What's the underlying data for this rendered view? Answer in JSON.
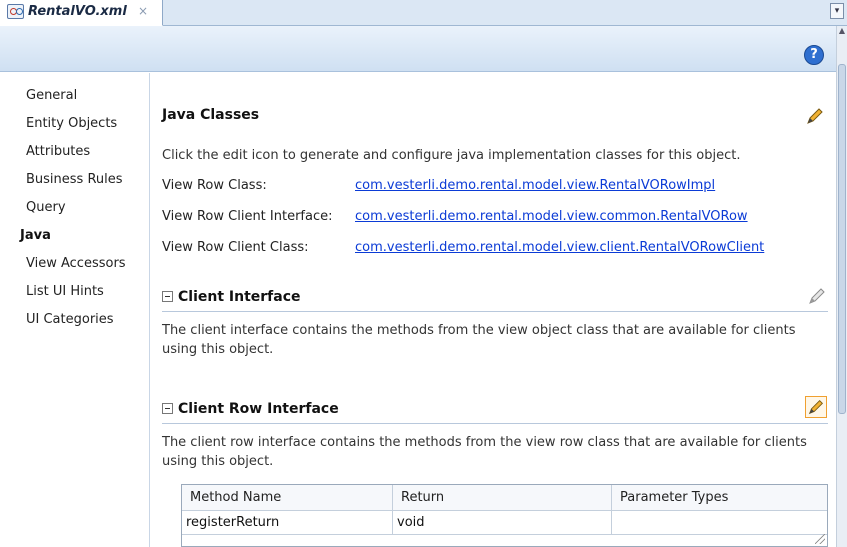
{
  "tab": {
    "title": "RentalVO.xml",
    "close": "×",
    "menu": "▾"
  },
  "header": {
    "help": "?"
  },
  "sidebar": {
    "items": [
      {
        "label": "General"
      },
      {
        "label": "Entity Objects"
      },
      {
        "label": "Attributes"
      },
      {
        "label": "Business Rules"
      },
      {
        "label": "Query"
      },
      {
        "label": "Java",
        "active": true
      },
      {
        "label": "View Accessors"
      },
      {
        "label": "List UI Hints"
      },
      {
        "label": "UI Categories"
      }
    ]
  },
  "java_classes": {
    "title": "Java Classes",
    "description": "Click the edit icon to generate and configure java implementation classes for this object.",
    "rows": [
      {
        "label": "View Row Class:",
        "value": "com.vesterli.demo.rental.model.view.RentalVORowImpl"
      },
      {
        "label": "View Row Client Interface:",
        "value": "com.vesterli.demo.rental.model.view.common.RentalVORow"
      },
      {
        "label": "View Row Client Class:",
        "value": "com.vesterli.demo.rental.model.view.client.RentalVORowClient"
      }
    ]
  },
  "client_interface": {
    "title": "Client Interface",
    "description": "The client interface contains the methods from the view object class that are available for clients using this object."
  },
  "client_row_interface": {
    "title": "Client Row Interface",
    "description": "The client row interface contains the methods from the view row class that are available for clients using this object.",
    "table": {
      "columns": [
        "Method Name",
        "Return",
        "Parameter Types"
      ],
      "rows": [
        [
          "registerReturn",
          "void",
          ""
        ]
      ]
    }
  },
  "colors": {
    "link": "#0b3bd6",
    "accent": "#f0a030",
    "help": "#2f6fd0"
  },
  "icons": [
    "file-xml-icon",
    "close-icon",
    "menu-dropdown-icon",
    "help-icon",
    "pencil-icon",
    "collapse-icon",
    "resize-grip-icon"
  ]
}
